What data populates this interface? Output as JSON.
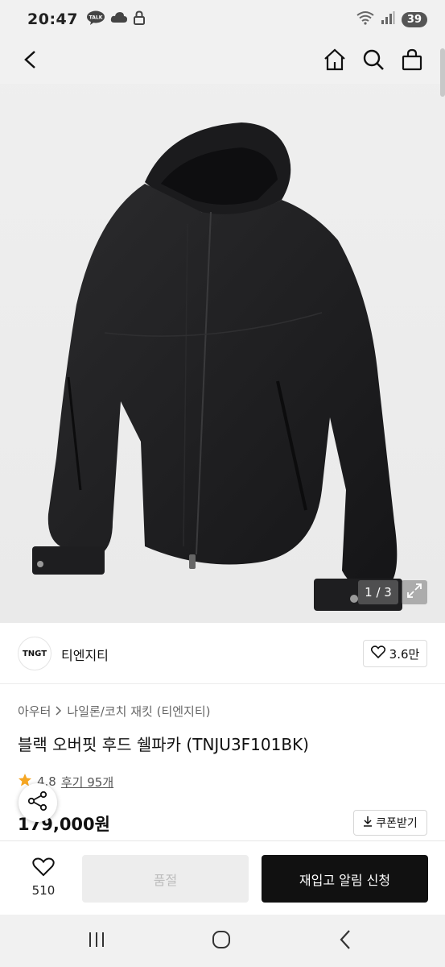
{
  "status_bar": {
    "time": "20:47",
    "battery": "39",
    "icons": [
      "talk-icon",
      "cloud-icon",
      "lock-icon",
      "wifi-icon",
      "signal-icon"
    ]
  },
  "header": {
    "icons": [
      "back-icon",
      "home-icon",
      "search-icon",
      "cart-icon"
    ]
  },
  "gallery": {
    "counter": "1 / 3",
    "image_subject": "black hooded jacket",
    "current": 1,
    "total": 3
  },
  "brand": {
    "logo_text": "TNGT",
    "name": "티엔지티",
    "likes": "3.6만"
  },
  "product": {
    "breadcrumb": [
      "아우터",
      "나일론/코치 재킷 (티엔지티)"
    ],
    "title": "블랙 오버핏 후드 쉘파카 (TNJU3F101BK)",
    "rating": "4.8",
    "reviews": "후기 95개",
    "price": "179,000원",
    "coupon_label": "쿠폰받기"
  },
  "action_bar": {
    "wish_count": "510",
    "soldout_label": "품절",
    "restock_label": "재입고 알림 신청"
  },
  "colors": {
    "accent_star": "#f5a623",
    "primary_button": "#111111",
    "disabled_button": "#ededed"
  }
}
